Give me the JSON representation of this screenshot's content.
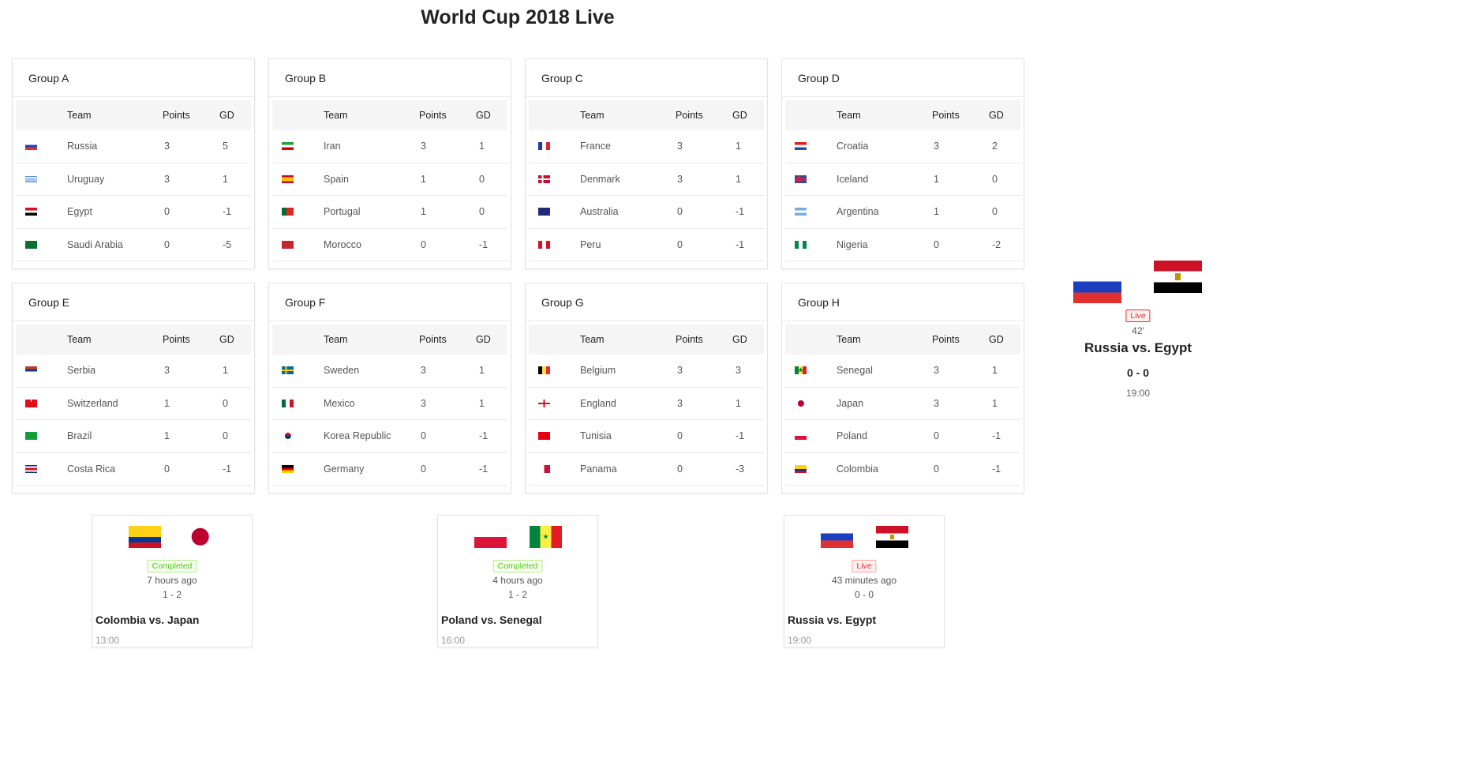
{
  "page": {
    "title": "World Cup 2018 Live"
  },
  "table_headers": {
    "team": "Team",
    "points": "Points",
    "gd": "GD"
  },
  "groups": [
    {
      "name": "Group A",
      "teams": [
        {
          "flag": "russia-flag",
          "team": "Russia",
          "points": "3",
          "gd": "5"
        },
        {
          "flag": "uruguay-flag",
          "team": "Uruguay",
          "points": "3",
          "gd": "1"
        },
        {
          "flag": "egypt-flag",
          "team": "Egypt",
          "points": "0",
          "gd": "-1"
        },
        {
          "flag": "saudi-arabia-flag",
          "team": "Saudi Arabia",
          "points": "0",
          "gd": "-5"
        }
      ]
    },
    {
      "name": "Group B",
      "teams": [
        {
          "flag": "iran-flag",
          "team": "Iran",
          "points": "3",
          "gd": "1"
        },
        {
          "flag": "spain-flag",
          "team": "Spain",
          "points": "1",
          "gd": "0"
        },
        {
          "flag": "portugal-flag",
          "team": "Portugal",
          "points": "1",
          "gd": "0"
        },
        {
          "flag": "morocco-flag",
          "team": "Morocco",
          "points": "0",
          "gd": "-1"
        }
      ]
    },
    {
      "name": "Group C",
      "teams": [
        {
          "flag": "france-flag",
          "team": "France",
          "points": "3",
          "gd": "1"
        },
        {
          "flag": "denmark-flag",
          "team": "Denmark",
          "points": "3",
          "gd": "1"
        },
        {
          "flag": "australia-flag",
          "team": "Australia",
          "points": "0",
          "gd": "-1"
        },
        {
          "flag": "peru-flag",
          "team": "Peru",
          "points": "0",
          "gd": "-1"
        }
      ]
    },
    {
      "name": "Group D",
      "teams": [
        {
          "flag": "croatia-flag",
          "team": "Croatia",
          "points": "3",
          "gd": "2"
        },
        {
          "flag": "iceland-flag",
          "team": "Iceland",
          "points": "1",
          "gd": "0"
        },
        {
          "flag": "argentina-flag",
          "team": "Argentina",
          "points": "1",
          "gd": "0"
        },
        {
          "flag": "nigeria-flag",
          "team": "Nigeria",
          "points": "0",
          "gd": "-2"
        }
      ]
    },
    {
      "name": "Group E",
      "teams": [
        {
          "flag": "serbia-flag",
          "team": "Serbia",
          "points": "3",
          "gd": "1"
        },
        {
          "flag": "switzerland-flag",
          "team": "Switzerland",
          "points": "1",
          "gd": "0"
        },
        {
          "flag": "brazil-flag",
          "team": "Brazil",
          "points": "1",
          "gd": "0"
        },
        {
          "flag": "costa-rica-flag",
          "team": "Costa Rica",
          "points": "0",
          "gd": "-1"
        }
      ]
    },
    {
      "name": "Group F",
      "teams": [
        {
          "flag": "sweden-flag",
          "team": "Sweden",
          "points": "3",
          "gd": "1"
        },
        {
          "flag": "mexico-flag",
          "team": "Mexico",
          "points": "3",
          "gd": "1"
        },
        {
          "flag": "korea-republic-flag",
          "team": "Korea Republic",
          "points": "0",
          "gd": "-1"
        },
        {
          "flag": "germany-flag",
          "team": "Germany",
          "points": "0",
          "gd": "-1"
        }
      ]
    },
    {
      "name": "Group G",
      "teams": [
        {
          "flag": "belgium-flag",
          "team": "Belgium",
          "points": "3",
          "gd": "3"
        },
        {
          "flag": "england-flag",
          "team": "England",
          "points": "3",
          "gd": "1"
        },
        {
          "flag": "tunisia-flag",
          "team": "Tunisia",
          "points": "0",
          "gd": "-1"
        },
        {
          "flag": "panama-flag",
          "team": "Panama",
          "points": "0",
          "gd": "-3"
        }
      ]
    },
    {
      "name": "Group H",
      "teams": [
        {
          "flag": "senegal-flag",
          "team": "Senegal",
          "points": "3",
          "gd": "1"
        },
        {
          "flag": "japan-flag",
          "team": "Japan",
          "points": "3",
          "gd": "1"
        },
        {
          "flag": "poland-flag",
          "team": "Poland",
          "points": "0",
          "gd": "-1"
        },
        {
          "flag": "colombia-flag",
          "team": "Colombia",
          "points": "0",
          "gd": "-1"
        }
      ]
    }
  ],
  "matches": [
    {
      "home_flag": "colombia-flag",
      "away_flag": "japan-flag",
      "status": "Completed",
      "status_kind": "completed",
      "ago": "7 hours ago",
      "score": "1 - 2",
      "name": "Colombia vs. Japan",
      "time": "13:00"
    },
    {
      "home_flag": "poland-flag",
      "away_flag": "senegal-flag",
      "status": "Completed",
      "status_kind": "completed",
      "ago": "4 hours ago",
      "score": "1 - 2",
      "name": "Poland vs. Senegal",
      "time": "16:00"
    },
    {
      "home_flag": "russia-flag",
      "away_flag": "egypt-flag",
      "status": "Live",
      "status_kind": "live",
      "ago": "43 minutes ago",
      "score": "0 - 0",
      "name": "Russia vs. Egypt",
      "time": "19:00"
    }
  ],
  "featured": {
    "home_flag": "russia-flag",
    "away_flag": "egypt-flag",
    "status": "Live",
    "minute": "42'",
    "name": "Russia vs. Egypt",
    "score": "0 - 0",
    "time": "19:00"
  },
  "colors": {
    "completed": "#52c41a",
    "live": "#f5222d",
    "header_bg": "#f5f5f5",
    "border": "#e8e8e8"
  }
}
